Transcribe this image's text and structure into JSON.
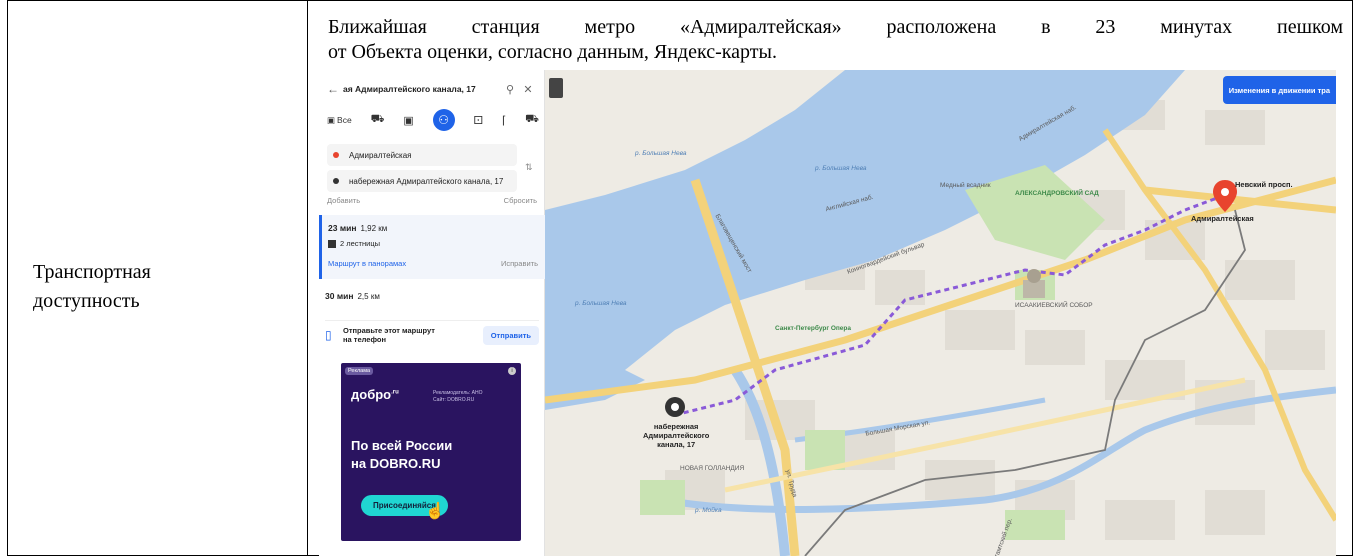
{
  "left_cell": {
    "label_line1": "Транспортная",
    "label_line2": "доступность"
  },
  "right_cell": {
    "line1": "Ближайшая станция метро «Адмиралтейская» расположена в 23 минутах пешком",
    "line2": "от Объекта оценки, согласно данным, Яндекс-карты."
  },
  "route_panel": {
    "search_text": "ая Адмиралтейского канала, 17",
    "mode_all": "Все",
    "from_stop": "Адмиралтейская",
    "to_stop": "набережная Адмиралтейского канала, 17",
    "add_label": "Добавить",
    "reset_label": "Сбросить",
    "route1": {
      "time": "23 мин",
      "distance": "1,92 км",
      "stairs": "2 лестницы",
      "panorama_link": "Маршрут в панорамах",
      "fix_link": "Исправить"
    },
    "route2": {
      "time": "30 мин",
      "distance": "2,5 км"
    },
    "send": {
      "text_line1": "Отправьте этот маршрут",
      "text_line2": "на телефон",
      "button": "Отправить"
    },
    "ad": {
      "tag": "Реклама",
      "logo": "добро",
      "logo_suffix": ".ru",
      "advertiser_line1": "Рекламодатель: АНО",
      "advertiser_line2": "Сайт: DOBRO.RU",
      "headline_line1": "По всей России",
      "headline_line2": "на DOBRO.RU",
      "join_button": "Присоединяйся"
    }
  },
  "map": {
    "changes_button": "Изменения в движении тра",
    "labels": {
      "neva1": "р. Большая Нева",
      "neva2": "р. Большая Нева",
      "neva3": "р. Большая Нева",
      "nevsky": "Невский просп.",
      "admiralteyskaya": "Адмиралтейская",
      "dest1": "набережная",
      "dest2": "Адмиралтейского",
      "dest3": "канала, 17",
      "blagov": "Благовещенский мост",
      "truda": "ул. Труда",
      "bolmorskaya": "Большая Морская ул.",
      "isaac": "ИСААКИЕВСКИЙ СОБОР",
      "aleks_sad": "АЛЕКСАНДРОВСКИЙ САД",
      "medny": "Медный всадник",
      "spb_opera": "Санкт-Петербург Опера",
      "novaya_gol": "НОВАЯ ГОЛЛАНДИЯ",
      "moyka": "р. Мойка",
      "angl_nab": "Английская наб.",
      "dvorts_nab": "Адмиралтейская наб.",
      "pochtamt": "Почтамтский пер.",
      "konn_bul": "Конногвардейский бульвар"
    },
    "colors": {
      "water": "#a9c8ea",
      "road": "#f3d27a",
      "route": "#8a5ad8",
      "pin": "#e8442e"
    }
  }
}
